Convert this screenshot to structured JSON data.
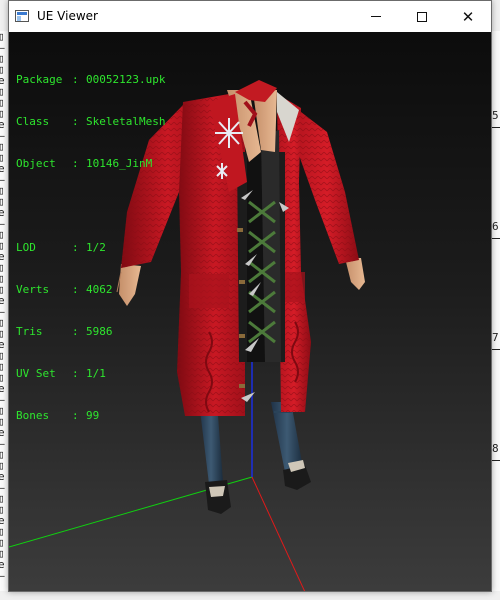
{
  "window": {
    "title": "UE Viewer"
  },
  "controls": {
    "minimize": "minimize",
    "maximize": "maximize",
    "close": "close"
  },
  "info": {
    "package": {
      "label": "Package",
      "value": "00052123.upk"
    },
    "class": {
      "label": "Class",
      "value": "SkeletalMesh"
    },
    "object": {
      "label": "Object",
      "value": "10146_JinM"
    },
    "lod": {
      "label": "LOD",
      "value": "1/2"
    },
    "verts": {
      "label": "Verts",
      "value": "4062"
    },
    "tris": {
      "label": "Tris",
      "value": "5986"
    },
    "uvset": {
      "label": "UV Set",
      "value": "1/1"
    },
    "bones": {
      "label": "Bones",
      "value": "99"
    }
  },
  "background_window": {
    "right_numbers": [
      "5",
      "6",
      "7",
      "8"
    ]
  },
  "colors": {
    "info_text": "#2ee62e",
    "coat": "#c4141f",
    "axis_x": "#e01a1a",
    "axis_y": "#10d010",
    "axis_z": "#1a2ee0"
  }
}
